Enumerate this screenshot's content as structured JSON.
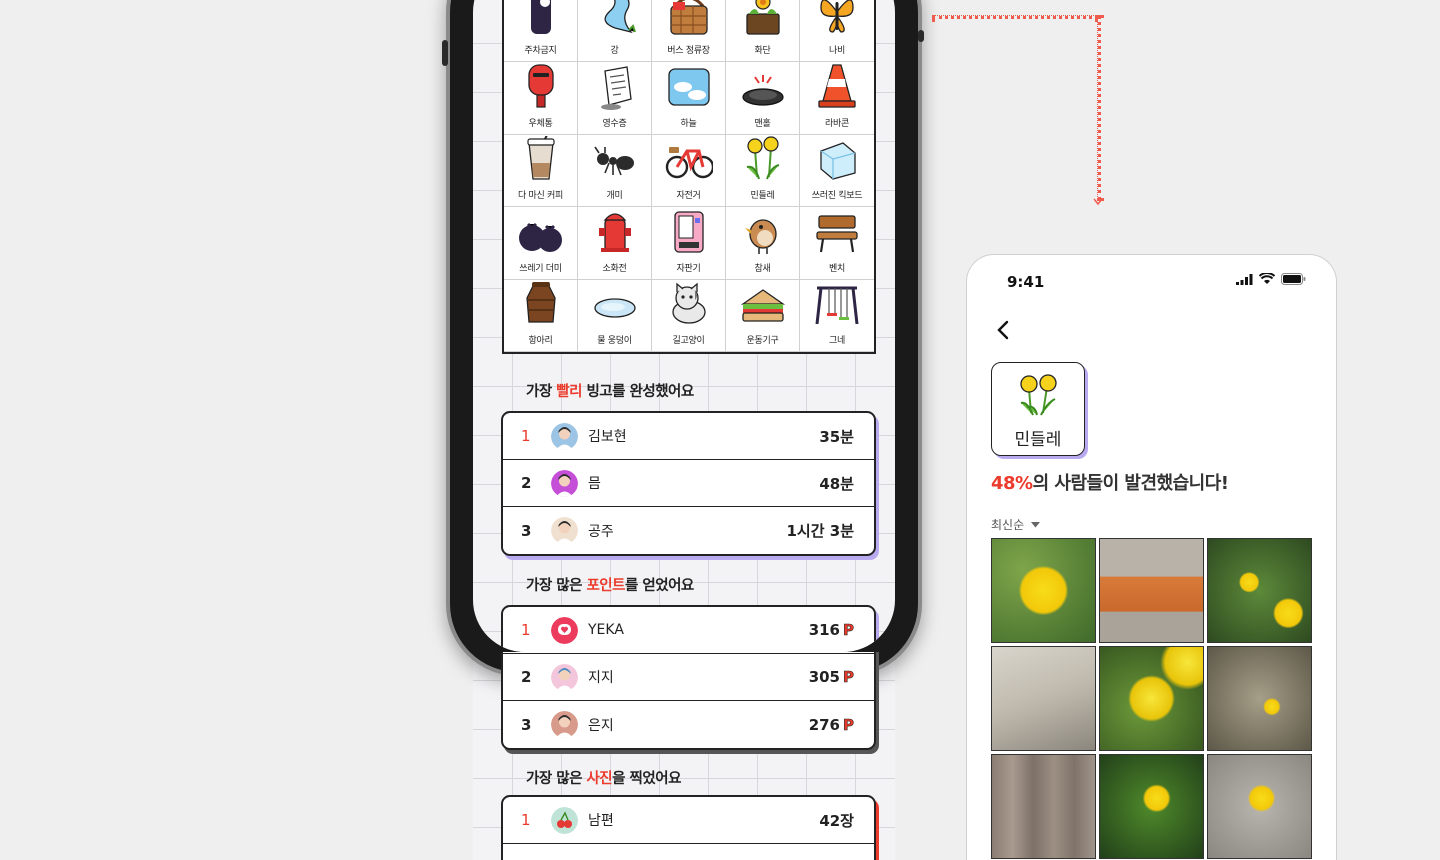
{
  "bingo": {
    "cells": [
      {
        "label": "주차금지",
        "icon": "parking-icon"
      },
      {
        "label": "강",
        "icon": "river-icon"
      },
      {
        "label": "버스 정류장",
        "icon": "picnic-basket-icon"
      },
      {
        "label": "화단",
        "icon": "flower-bed-icon"
      },
      {
        "label": "나비",
        "icon": "butterfly-icon"
      },
      {
        "label": "우체통",
        "icon": "postbox-icon"
      },
      {
        "label": "영수증",
        "icon": "receipt-icon"
      },
      {
        "label": "하늘",
        "icon": "sky-icon"
      },
      {
        "label": "맨홀",
        "icon": "manhole-icon"
      },
      {
        "label": "라바콘",
        "icon": "traffic-cone-icon"
      },
      {
        "label": "다 마신 커피",
        "icon": "iced-coffee-icon"
      },
      {
        "label": "개미",
        "icon": "ant-icon"
      },
      {
        "label": "자전거",
        "icon": "bicycle-icon"
      },
      {
        "label": "민들레",
        "icon": "dandelion-icon"
      },
      {
        "label": "쓰러진 킥보드",
        "icon": "ice-cube-icon"
      },
      {
        "label": "쓰레기 더미",
        "icon": "trash-bags-icon"
      },
      {
        "label": "소화전",
        "icon": "fire-hydrant-icon"
      },
      {
        "label": "자판기",
        "icon": "vending-machine-icon"
      },
      {
        "label": "참새",
        "icon": "sparrow-icon"
      },
      {
        "label": "벤치",
        "icon": "bench-icon"
      },
      {
        "label": "항아리",
        "icon": "jar-icon"
      },
      {
        "label": "물 웅덩이",
        "icon": "puddle-icon"
      },
      {
        "label": "길고양이",
        "icon": "street-cat-icon"
      },
      {
        "label": "운동기구",
        "icon": "sandwich-icon"
      },
      {
        "label": "그네",
        "icon": "swing-icon"
      }
    ]
  },
  "sections": {
    "fastest": {
      "pre": "가장 ",
      "hl": "빨리",
      "post": " 빙고를 완성했어요",
      "rows": [
        {
          "rank": "1",
          "name": "김보현",
          "value": "35분"
        },
        {
          "rank": "2",
          "name": "믐",
          "value": "48분"
        },
        {
          "rank": "3",
          "name": "공주",
          "value": "1시간 3분"
        }
      ]
    },
    "points": {
      "pre": "가장 많은 ",
      "hl": "포인트",
      "post": "를 얻었어요",
      "rows": [
        {
          "rank": "1",
          "name": "YEKA",
          "value": "316"
        },
        {
          "rank": "2",
          "name": "지지",
          "value": "305"
        },
        {
          "rank": "3",
          "name": "은지",
          "value": "276"
        }
      ],
      "point_symbol": "P"
    },
    "photos": {
      "pre": "가장 많은 ",
      "hl": "사진",
      "post": "을 찍었어요",
      "rows": [
        {
          "rank": "1",
          "name": "남편",
          "value": "42장"
        }
      ]
    }
  },
  "detail": {
    "status_time": "9:41",
    "item_label": "민들레",
    "pct": "48%",
    "headline_rest": "의 사람들이 발견했습니다!",
    "sort_label": "최신순",
    "photo_count": 9
  },
  "colors": {
    "accent": "#ec3b2c",
    "shadow_purple": "#b9aaf0",
    "dandelion": "#f2d516"
  }
}
